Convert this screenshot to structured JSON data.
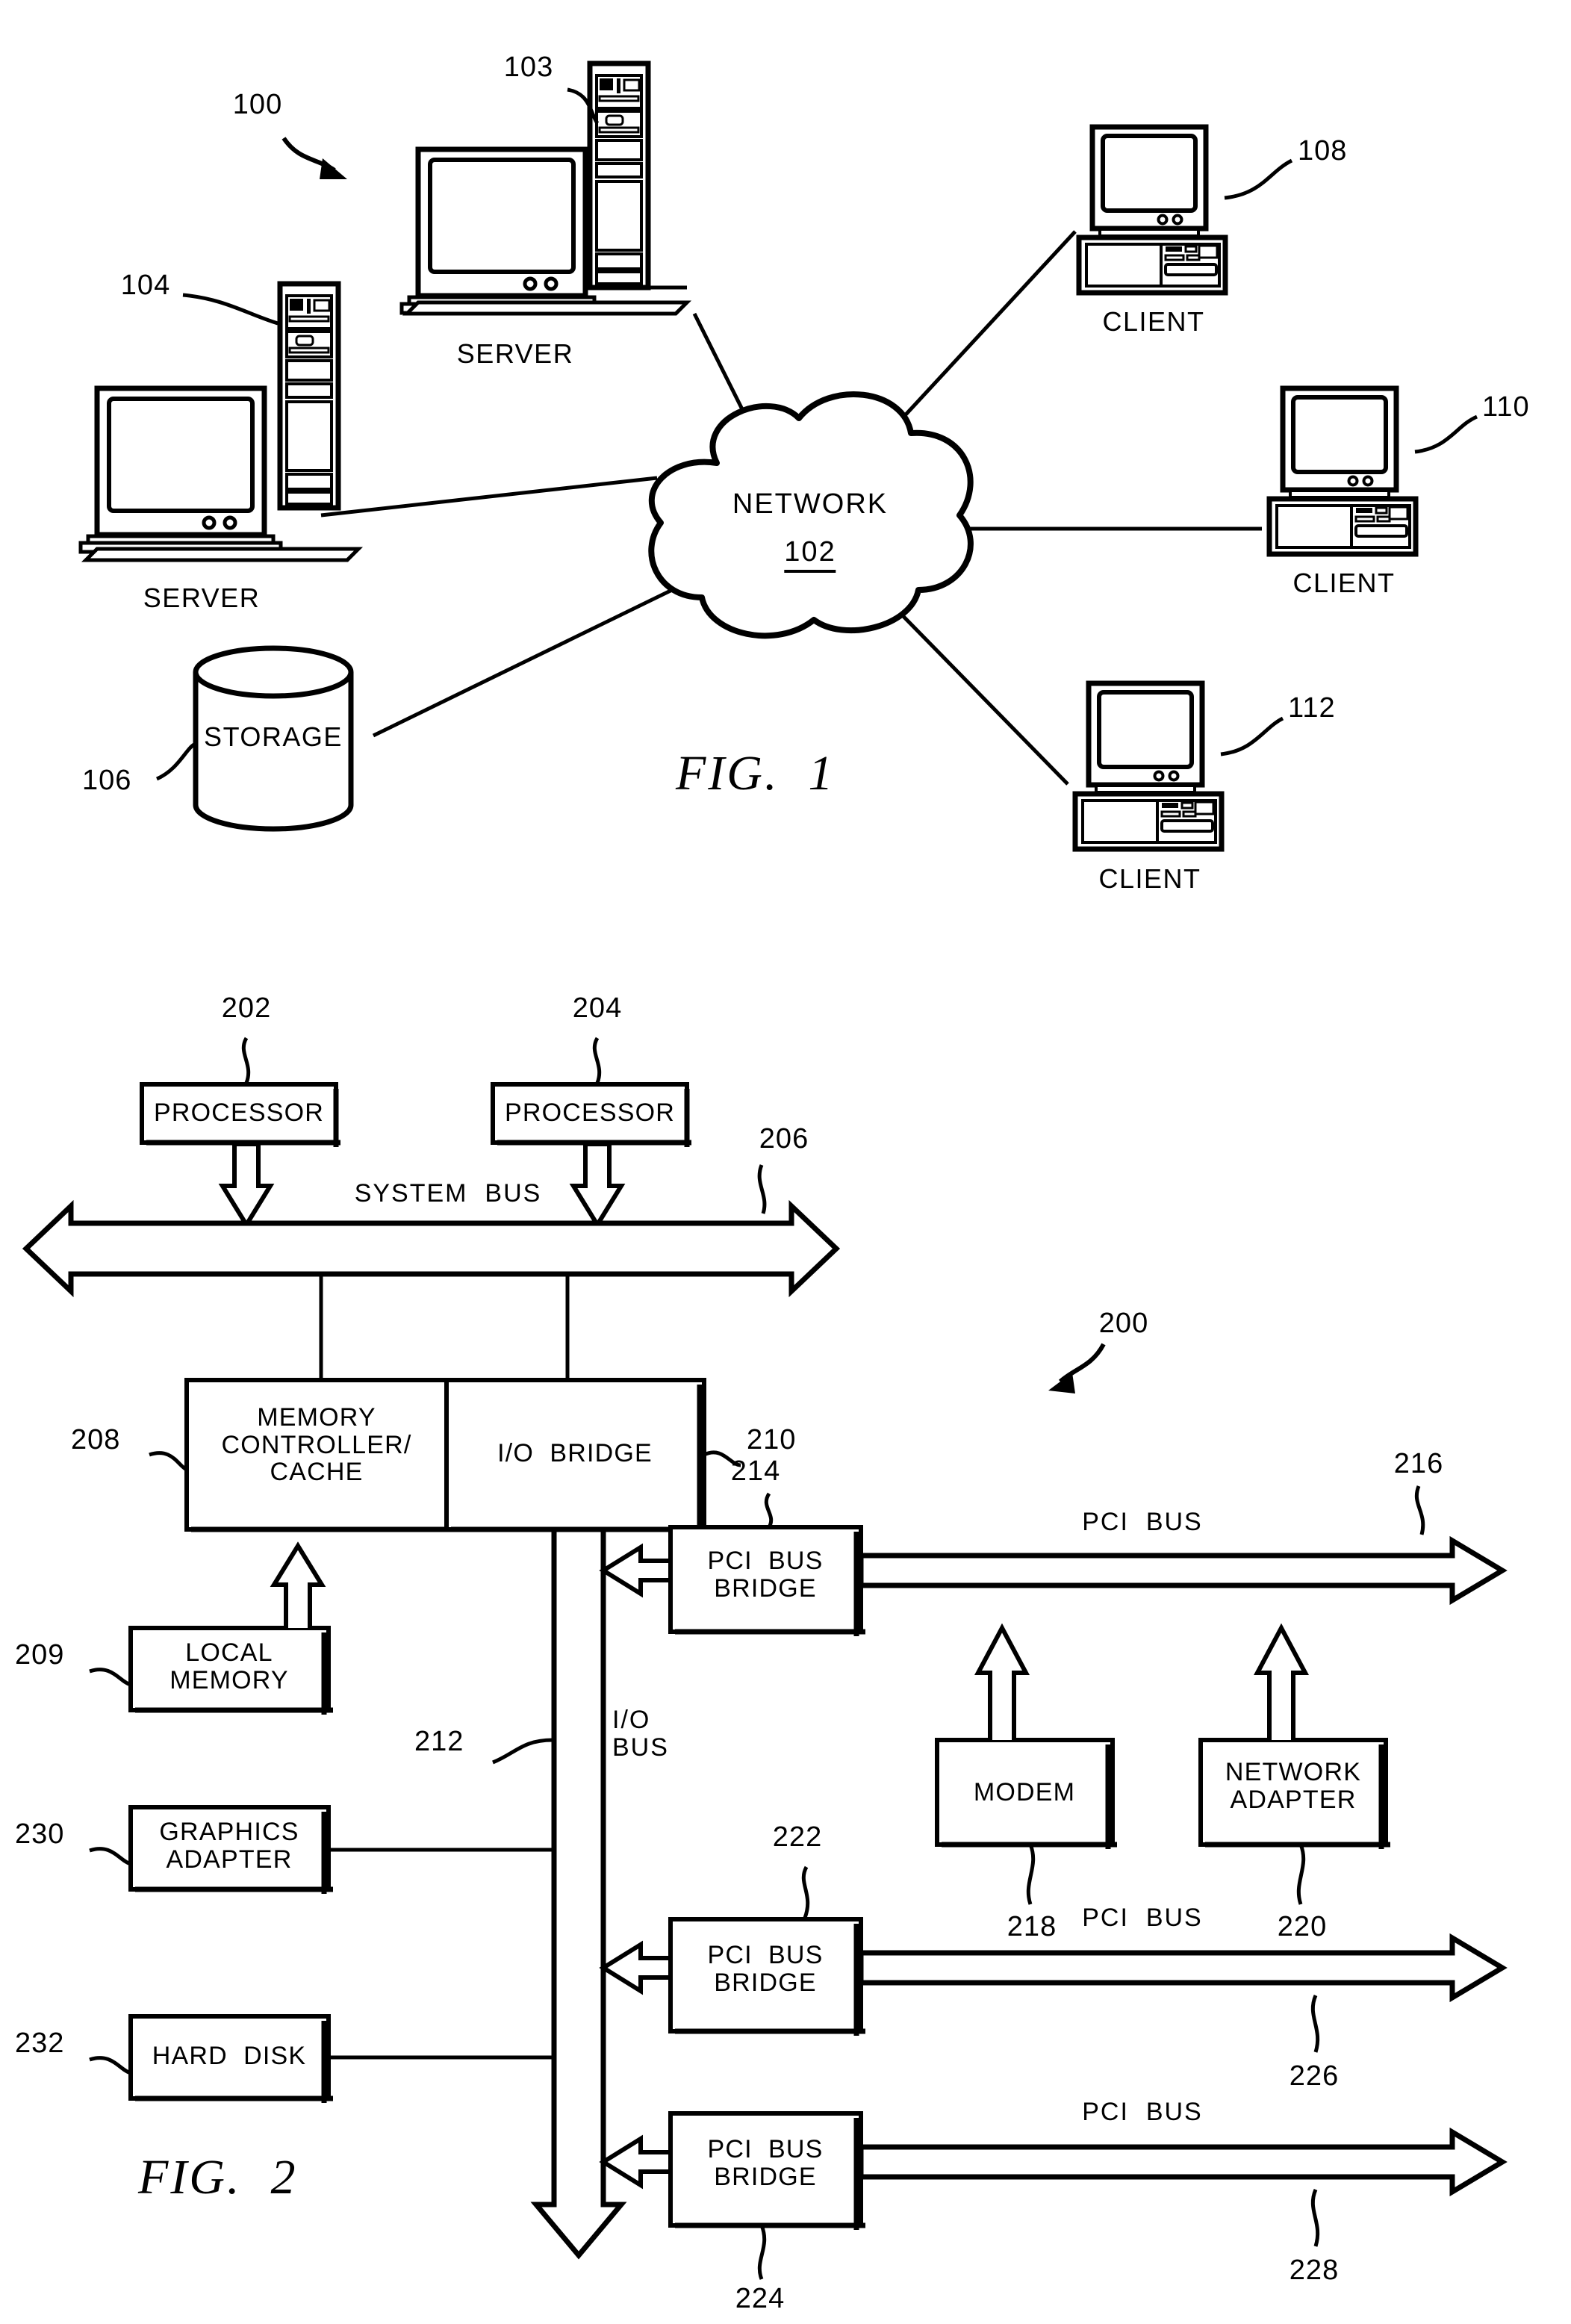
{
  "figure1": {
    "caption": "FIG.  1",
    "system_ref": "100",
    "network": {
      "label": "NETWORK",
      "ref": "102"
    },
    "nodes": [
      {
        "id": "server-103",
        "ref": "103",
        "label": "SERVER",
        "kind": "tower-server"
      },
      {
        "id": "server-104",
        "ref": "104",
        "label": "SERVER",
        "kind": "tower-server"
      },
      {
        "id": "storage-106",
        "ref": "106",
        "label": "STORAGE",
        "kind": "cylinder"
      },
      {
        "id": "client-108",
        "ref": "108",
        "label": "CLIENT",
        "kind": "desktop-client"
      },
      {
        "id": "client-110",
        "ref": "110",
        "label": "CLIENT",
        "kind": "desktop-client"
      },
      {
        "id": "client-112",
        "ref": "112",
        "label": "CLIENT",
        "kind": "desktop-client"
      }
    ]
  },
  "figure2": {
    "caption": "FIG.  2",
    "system_ref": "200",
    "blocks": [
      {
        "id": "processor-202",
        "ref": "202",
        "label": "PROCESSOR"
      },
      {
        "id": "processor-204",
        "ref": "204",
        "label": "PROCESSOR"
      },
      {
        "id": "memory-controller-208",
        "ref": "208",
        "label": "MEMORY\nCONTROLLER/\nCACHE"
      },
      {
        "id": "io-bridge-210",
        "ref": "210",
        "label": "I/O  BRIDGE"
      },
      {
        "id": "local-memory-209",
        "ref": "209",
        "label": "LOCAL\nMEMORY"
      },
      {
        "id": "graphics-adapter-230",
        "ref": "230",
        "label": "GRAPHICS\nADAPTER"
      },
      {
        "id": "hard-disk-232",
        "ref": "232",
        "label": "HARD  DISK"
      },
      {
        "id": "pci-bus-bridge-214",
        "ref": "214",
        "label": "PCI  BUS\nBRIDGE"
      },
      {
        "id": "pci-bus-bridge-222",
        "ref": "222",
        "label": "PCI  BUS\nBRIDGE"
      },
      {
        "id": "pci-bus-bridge-224",
        "ref": "224",
        "label": "PCI  BUS\nBRIDGE"
      },
      {
        "id": "modem-218",
        "ref": "218",
        "label": "MODEM"
      },
      {
        "id": "network-adapter-220",
        "ref": "220",
        "label": "NETWORK\nADAPTER"
      }
    ],
    "buses": [
      {
        "id": "system-bus-206",
        "ref": "206",
        "label": "SYSTEM  BUS"
      },
      {
        "id": "io-bus-212",
        "ref": "212",
        "label": "I/O\nBUS"
      },
      {
        "id": "pci-bus-216",
        "ref": "216",
        "label": "PCI  BUS"
      },
      {
        "id": "pci-bus-226",
        "ref": "226",
        "label": "PCI  BUS"
      },
      {
        "id": "pci-bus-228",
        "ref": "228",
        "label": "PCI  BUS"
      }
    ]
  },
  "colors": {
    "ink": "#000000",
    "paper": "#ffffff"
  }
}
